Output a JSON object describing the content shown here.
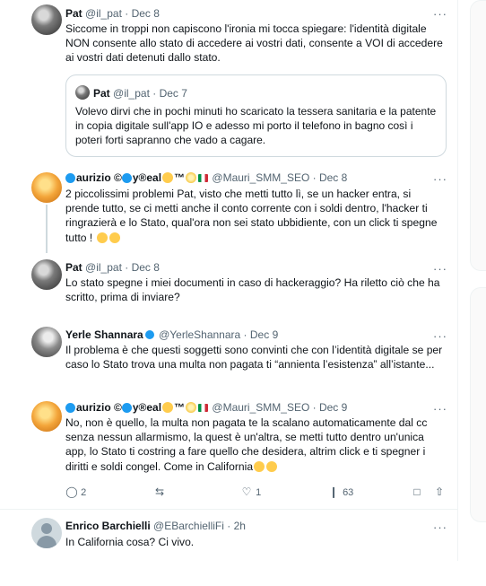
{
  "tweets": [
    {
      "name": "Pat",
      "handle": "@il_pat",
      "date": "Dec 8",
      "text": "Siccome in troppi non capiscono l'ironia mi tocca spiegare: l'identità digitale NON consente allo stato di accedere ai vostri dati, consente a VOI di accedere ai vostri dati detenuti dallo stato.",
      "quote": {
        "name": "Pat",
        "handle": "@il_pat",
        "date": "Dec 7",
        "text": "Volevo dirvi che in pochi minuti ho scaricato la tessera sanitaria e la patente in copia digitale sull'app IO e adesso mi porto il telefono in bagno così i poteri forti sapranno che vado a cagare."
      }
    },
    {
      "name_prefix": "aurizio ©",
      "name_mid": "y®eal",
      "name_suffix": "™",
      "handle": "@Mauri_SMM_SEO",
      "date": "Dec 8",
      "text": "2 piccolissimi problemi Pat, visto che metti tutto lì, se un hacker entra, si prende tutto, se ci metti anche il conto corrente con i soldi dentro, l'hacker ti ringrazierà e lo Stato, qual'ora non sei stato ubbidiente, con un click ti spegne tutto !"
    },
    {
      "name": "Pat",
      "handle": "@il_pat",
      "date": "Dec 8",
      "text": "Lo stato spegne i miei documenti in caso di hackeraggio? Ha riletto ciò che ha scritto, prima di inviare?"
    },
    {
      "name": "Yerle Shannara",
      "handle": "@YerleShannara",
      "date": "Dec 9",
      "text": "Il problema è che questi soggetti sono convinti che con l’identità digitale se per caso lo Stato trova una multa non pagata ti “annienta l’esistenza” all’istante..."
    },
    {
      "name_prefix": "aurizio ©",
      "name_mid": "y®eal",
      "name_suffix": "™",
      "handle": "@Mauri_SMM_SEO",
      "date": "Dec 9",
      "text": "No, non è quello, la multa non pagata te la scalano automaticamente dal cc senza nessun allarmismo, la quest è un'altra, se metti tutto dentro un'unica app, lo Stato ti costring a fare quello che desidera, altrim click e ti spegner i diritti e soldi congel. Come in California",
      "stats": {
        "replies": "2",
        "retweets": "",
        "likes": "1",
        "views": "63"
      }
    },
    {
      "name": "Enrico Barchielli",
      "handle": "@EBarchielliFi",
      "date": "2h",
      "text": "In California cosa? Ci vivo."
    }
  ],
  "separator": "·",
  "more_label": "···",
  "icons": {
    "reply": "reply-icon",
    "retweet": "retweet-icon",
    "like": "heart-icon",
    "views": "views-icon",
    "bookmark": "bookmark-icon",
    "share": "share-icon"
  },
  "colors": {
    "accent": "#1d9bf0",
    "muted": "#536471",
    "border": "#cfd9de"
  }
}
